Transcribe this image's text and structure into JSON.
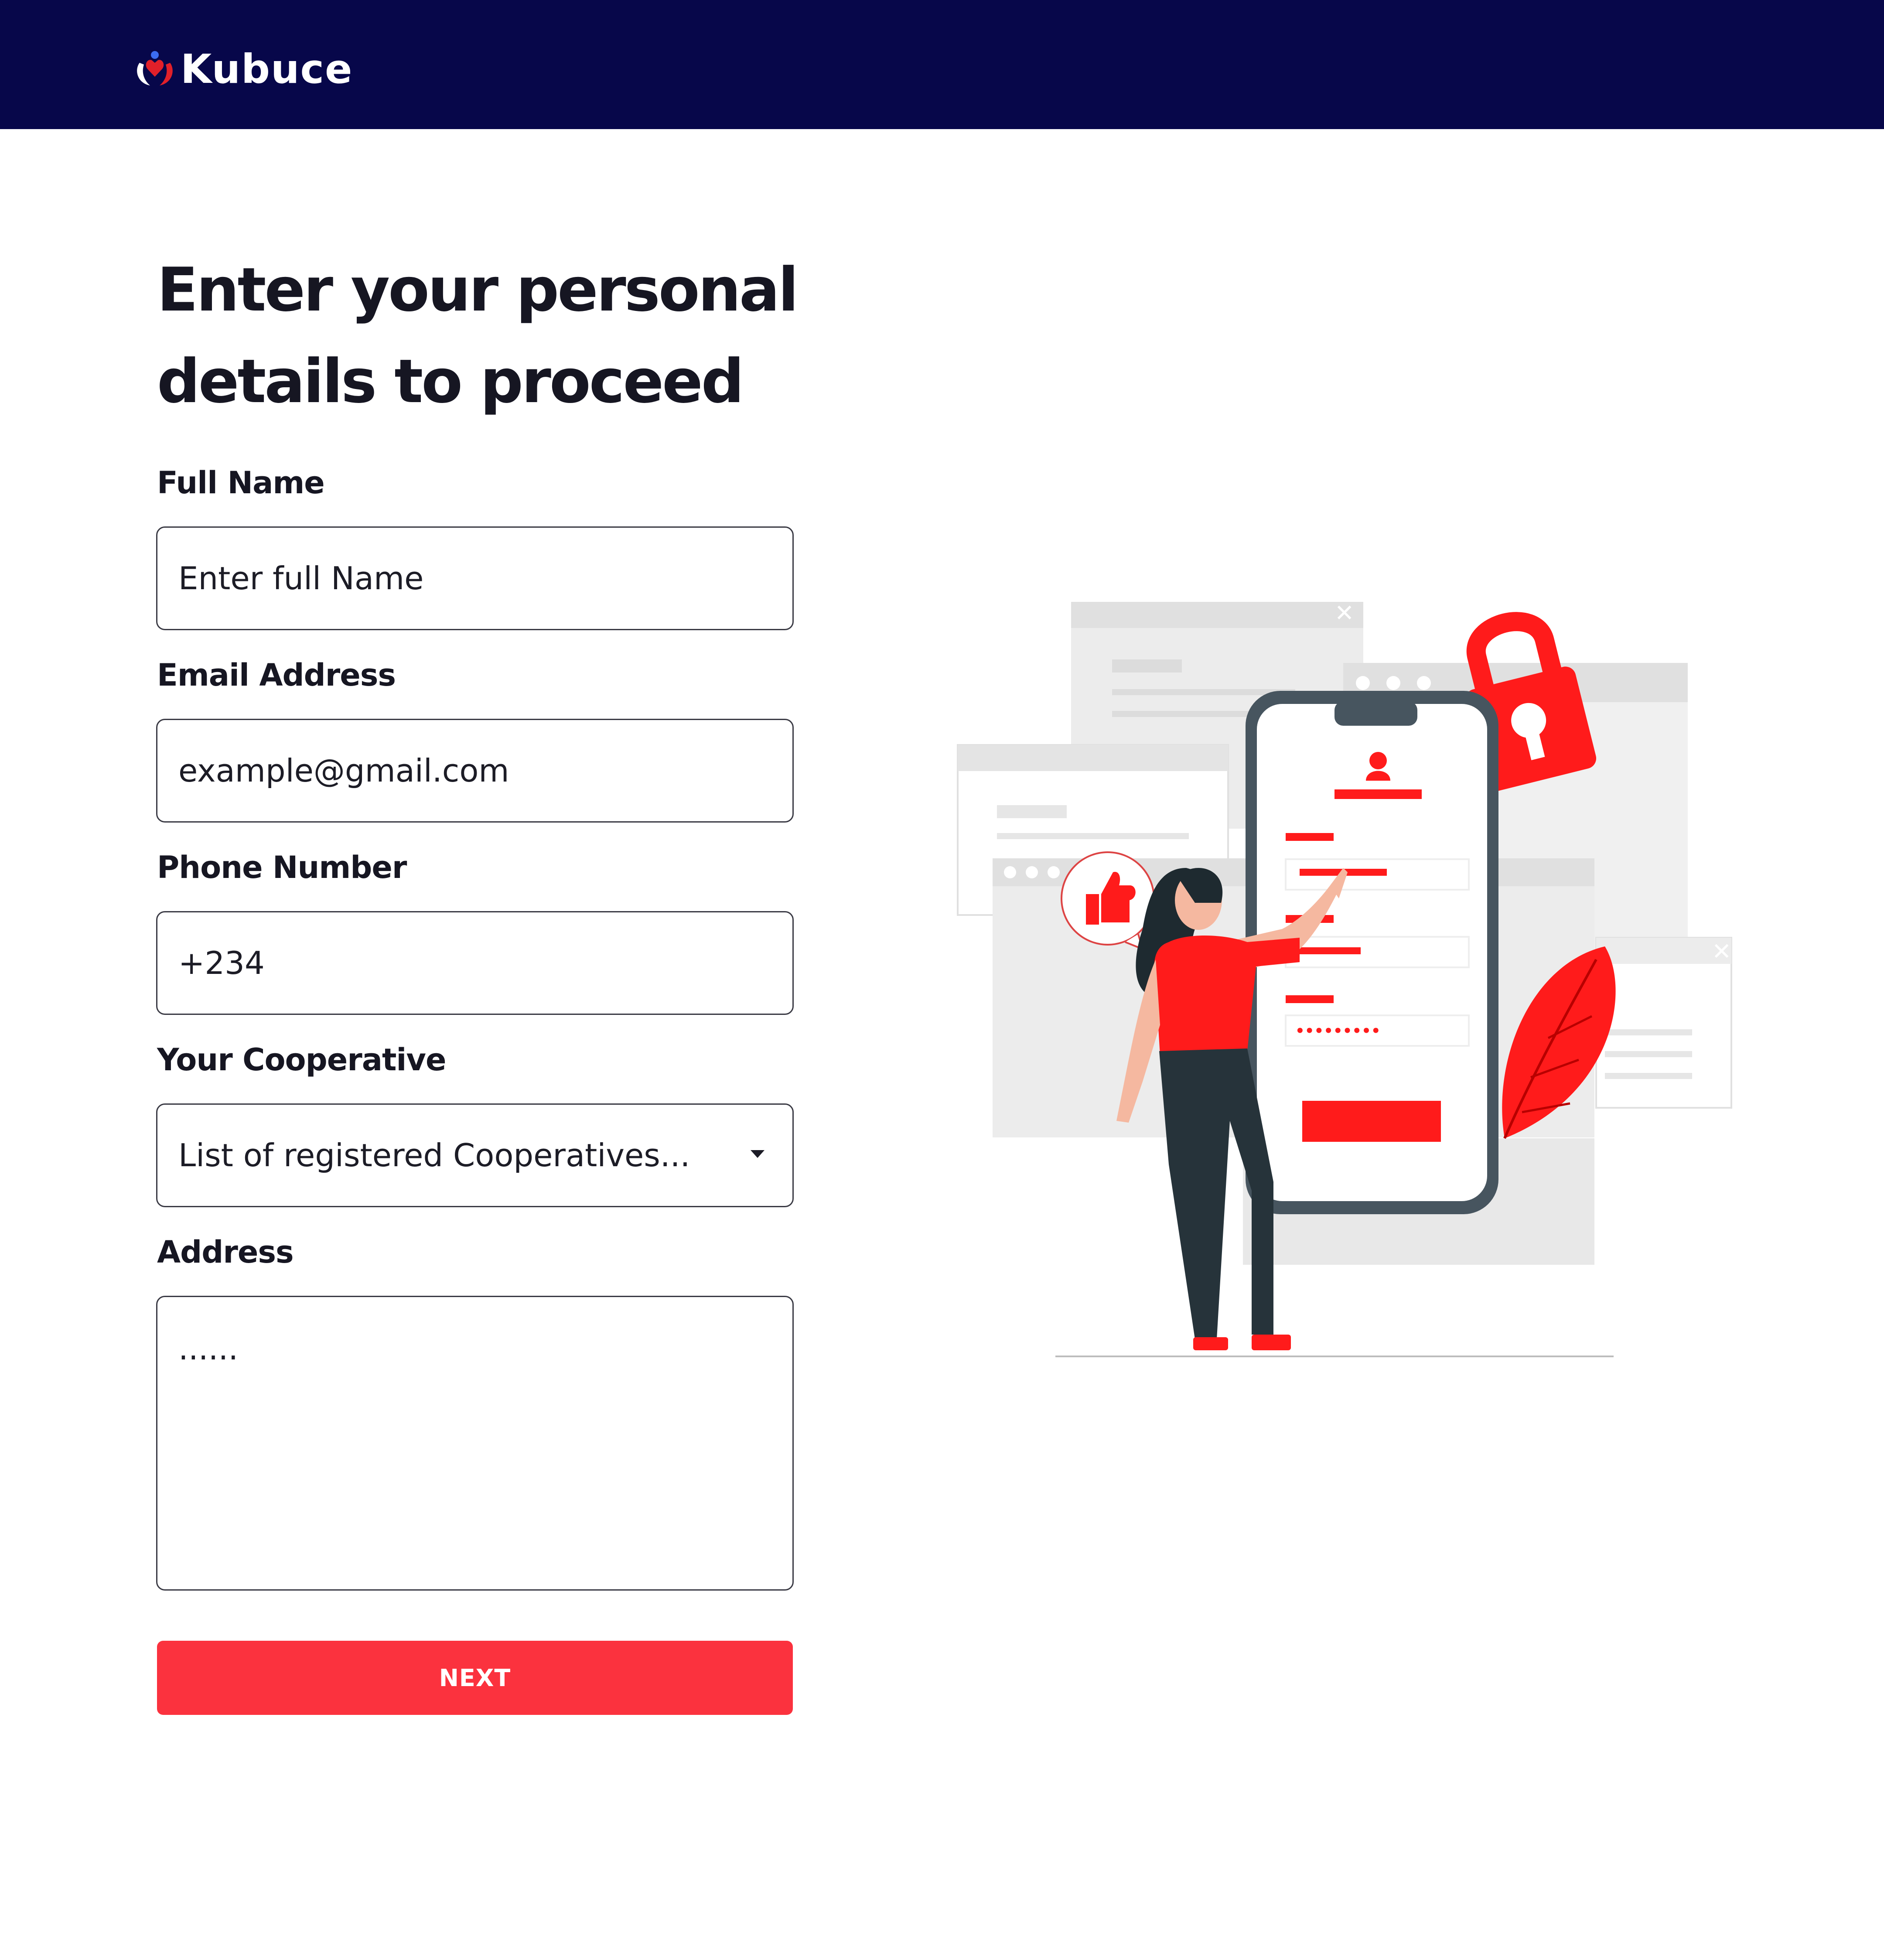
{
  "header": {
    "brand_name": "Kubuce",
    "logo_icon": "hands-heart-logo-icon",
    "background_color": "#07074a"
  },
  "form": {
    "heading": "Enter your personal details to proceed",
    "fields": {
      "full_name": {
        "label": "Full Name",
        "placeholder": "Enter full Name"
      },
      "email": {
        "label": "Email Address",
        "placeholder": "example@gmail.com"
      },
      "phone": {
        "label": "Phone Number",
        "value": "+234"
      },
      "cooperative": {
        "label": "Your Cooperative",
        "selected": "List of registered Cooperatives...",
        "icon": "caret-down-icon"
      },
      "address": {
        "label": "Address",
        "placeholder": "......"
      }
    },
    "next_button": "NEXT"
  },
  "illustration": {
    "subject": "woman-filling-login-form-on-phone",
    "phone_screen": {
      "password_dots": "•••••••••"
    }
  },
  "colors": {
    "accent": "#fb323e",
    "illustration_red": "#ff1b1b",
    "navy": "#07074a",
    "text": "#161622"
  }
}
